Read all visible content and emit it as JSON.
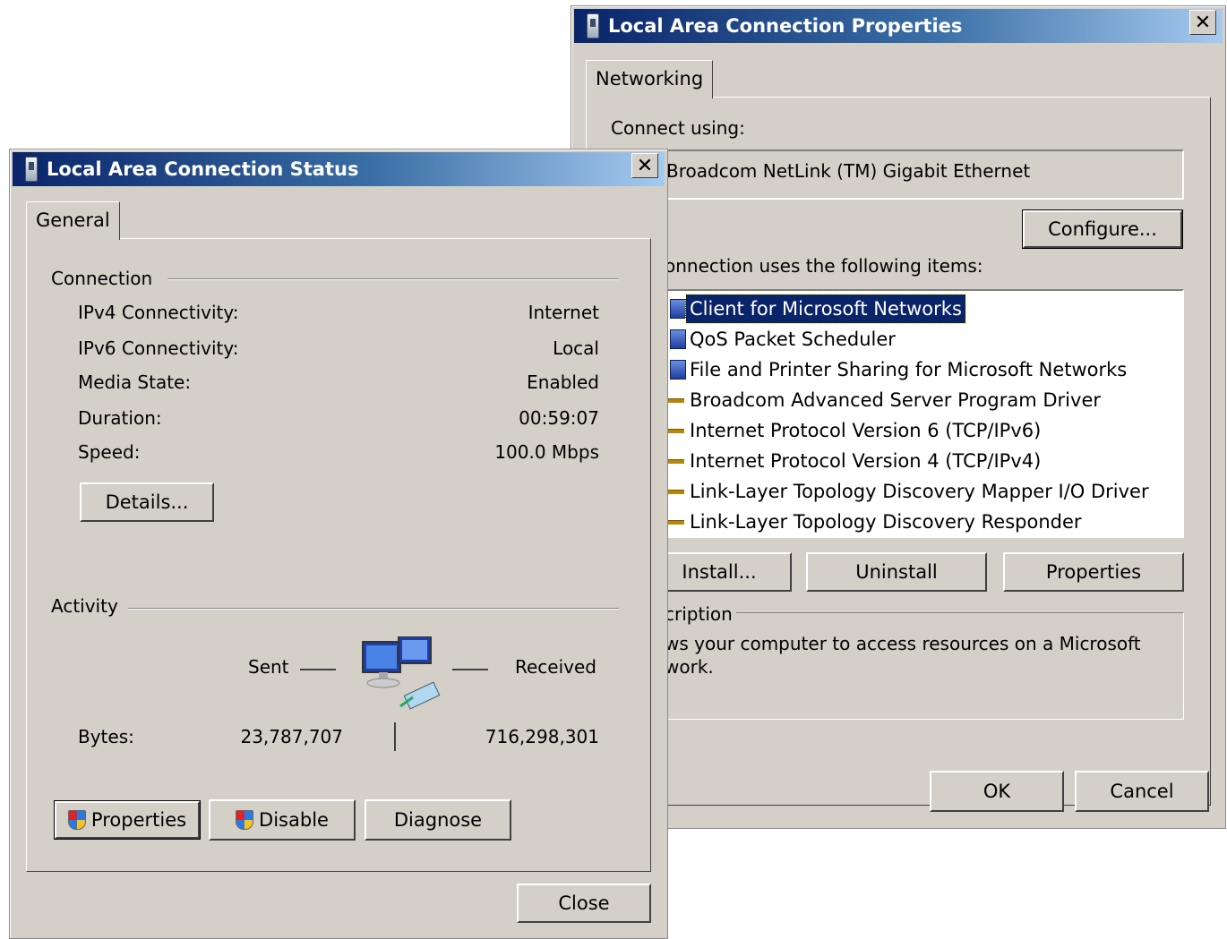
{
  "properties_dialog": {
    "title": "Local Area Connection Properties",
    "close_glyph": "✕",
    "tab": "Networking",
    "connect_using_label": "Connect using:",
    "adapter_name": "Broadcom NetLink (TM) Gigabit Ethernet",
    "configure_button": "Configure...",
    "items_label": "onnection uses the following items:",
    "items": [
      {
        "label": "Client for Microsoft Networks",
        "icon": "network-client-icon",
        "selected": true
      },
      {
        "label": "QoS Packet Scheduler",
        "icon": "network-client-icon",
        "selected": false
      },
      {
        "label": "File and Printer Sharing for Microsoft Networks",
        "icon": "network-client-icon",
        "selected": false
      },
      {
        "label": "Broadcom Advanced Server Program Driver",
        "icon": "protocol-icon",
        "selected": false
      },
      {
        "label": "Internet Protocol Version 6 (TCP/IPv6)",
        "icon": "protocol-icon",
        "selected": false
      },
      {
        "label": "Internet Protocol Version 4 (TCP/IPv4)",
        "icon": "protocol-icon",
        "selected": false
      },
      {
        "label": "Link-Layer Topology Discovery Mapper I/O Driver",
        "icon": "protocol-icon",
        "selected": false
      },
      {
        "label": "Link-Layer Topology Discovery Responder",
        "icon": "protocol-icon",
        "selected": false
      }
    ],
    "install_button": "Install...",
    "uninstall_button": "Uninstall",
    "properties_button": "Properties",
    "description_label": "cription",
    "description_line1": "ws your computer to access resources on a Microsoft",
    "description_line2": "work.",
    "ok_button": "OK",
    "cancel_button": "Cancel"
  },
  "status_dialog": {
    "title": "Local Area Connection Status",
    "close_glyph": "✕",
    "tab": "General",
    "connection_group": "Connection",
    "rows": [
      {
        "label": "IPv4 Connectivity:",
        "value": "Internet"
      },
      {
        "label": "IPv6 Connectivity:",
        "value": "Local"
      },
      {
        "label": "Media State:",
        "value": "Enabled"
      },
      {
        "label": "Duration:",
        "value": "00:59:07"
      },
      {
        "label": "Speed:",
        "value": "100.0 Mbps"
      }
    ],
    "details_button": "Details...",
    "activity_group": "Activity",
    "sent_label": "Sent",
    "received_label": "Received",
    "bytes_label": "Bytes:",
    "bytes_sent": "23,787,707",
    "bytes_received": "716,298,301",
    "properties_button": "Properties",
    "disable_button": "Disable",
    "diagnose_button": "Diagnose",
    "close_button": "Close"
  },
  "colors": {
    "dialog_face": "#d4d0c8",
    "titlebar_start": "#0a246a",
    "titlebar_end": "#a6caf0",
    "selection": "#0a246a"
  }
}
